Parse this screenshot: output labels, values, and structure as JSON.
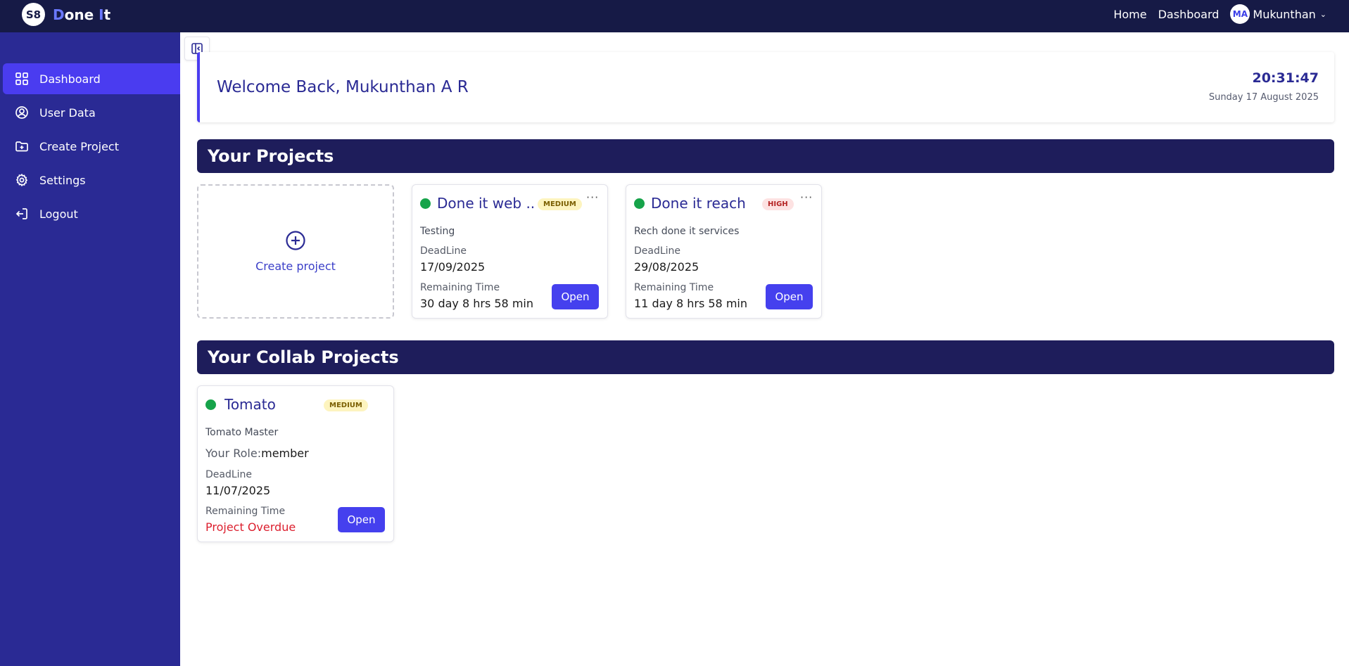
{
  "brand": {
    "logo_text": "S8",
    "name_first": "D",
    "name_middle": "one ",
    "name_accent": "I",
    "name_last": "t"
  },
  "topnav": {
    "home": "Home",
    "dashboard": "Dashboard",
    "avatar_initials": "MA",
    "user_name": "Mukunthan"
  },
  "sidebar": {
    "items": [
      {
        "label": "Dashboard",
        "icon": "grid-icon",
        "active": true
      },
      {
        "label": "User Data",
        "icon": "user-circle-icon"
      },
      {
        "label": "Create Project",
        "icon": "folder-plus-icon"
      },
      {
        "label": "Settings",
        "icon": "gear-icon"
      },
      {
        "label": "Logout",
        "icon": "logout-icon"
      }
    ]
  },
  "welcome": {
    "title": "Welcome Back, Mukunthan A R",
    "time": "20:31:47",
    "date": "Sunday 17 August 2025"
  },
  "projects": {
    "header": "Your Projects",
    "create_label": "Create project",
    "items": [
      {
        "title": "Done it web ...",
        "priority": "MEDIUM",
        "description": "Testing",
        "deadline_label": "DeadLine",
        "deadline": "17/09/2025",
        "remaining_label": "Remaining Time",
        "remaining": "30 day 8 hrs 58 min",
        "open_label": "Open"
      },
      {
        "title": "Done it reach",
        "priority": "HIGH",
        "description": "Rech done it services",
        "deadline_label": "DeadLine",
        "deadline": "29/08/2025",
        "remaining_label": "Remaining Time",
        "remaining": "11 day 8 hrs 58 min",
        "open_label": "Open"
      }
    ]
  },
  "collab": {
    "header": "Your Collab Projects",
    "items": [
      {
        "title": "Tomato",
        "priority": "MEDIUM",
        "description": "Tomato Master",
        "role_label": "Your Role:",
        "role": "member",
        "deadline_label": "DeadLine",
        "deadline": "11/07/2025",
        "remaining_label": "Remaining Time",
        "remaining": "Project Overdue",
        "open_label": "Open"
      }
    ]
  },
  "colors": {
    "topbar": "#161a46",
    "sidebar": "#2a2a94",
    "active": "#4a3cf0",
    "button": "#4540ee",
    "status_active": "#16a34a",
    "overdue": "#dc1f2e"
  }
}
